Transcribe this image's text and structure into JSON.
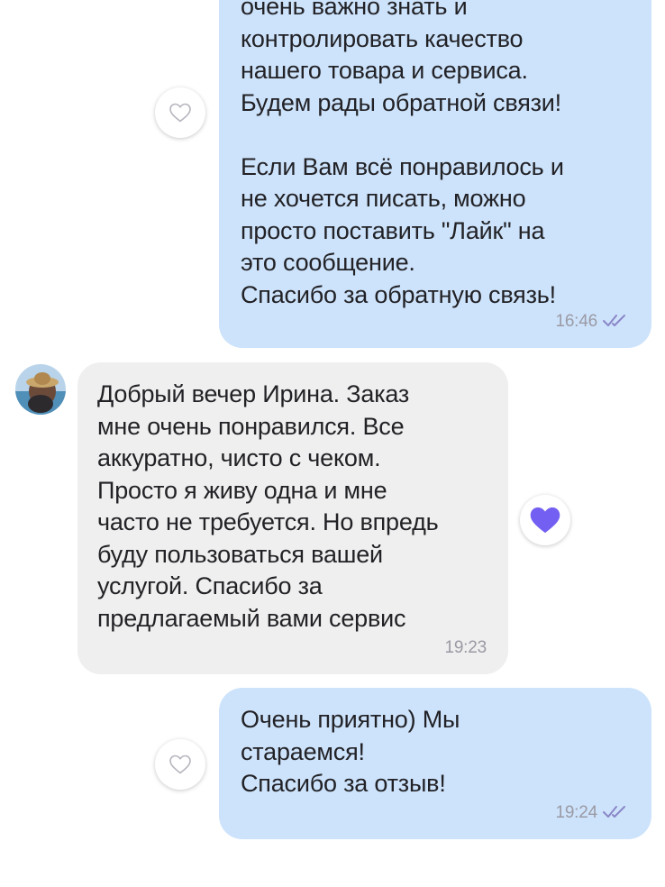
{
  "messages": [
    {
      "direction": "outgoing",
      "lines": [
        "очень важно знать и",
        "контролировать качество",
        "нашего товара и сервиса.",
        "Будем рады обратной связи!",
        "",
        "Если Вам всё понравилось и",
        "не хочется писать, можно",
        "просто поставить \"Лайк\" на",
        "это сообщение.",
        "Спасибо за обратную связь!"
      ],
      "time": "16:46",
      "status_icon": "double-check-icon",
      "liked": false
    },
    {
      "direction": "incoming",
      "lines": [
        "Добрый вечер Ирина. Заказ",
        "мне очень понравился. Все",
        "аккуратно, чисто с чеком.",
        "Просто я живу одна и мне",
        "часто не требуется. Но впредь",
        "буду пользоваться вашей",
        "услугой. Спасибо за",
        "предлагаемый вами сервис"
      ],
      "time": "19:23",
      "liked": true
    },
    {
      "direction": "outgoing",
      "lines": [
        "Очень приятно) Мы",
        "стараемся!",
        "Спасибо за отзыв!"
      ],
      "time": "19:24",
      "status_icon": "double-check-icon",
      "liked": false
    }
  ],
  "colors": {
    "outgoing_bubble": "#cde3fb",
    "incoming_bubble": "#efefef",
    "heart_liked": "#7360f2",
    "heart_outline": "#b5b5bd",
    "meta_text": "#9a9aa4",
    "check_marks": "#8a86c7"
  }
}
